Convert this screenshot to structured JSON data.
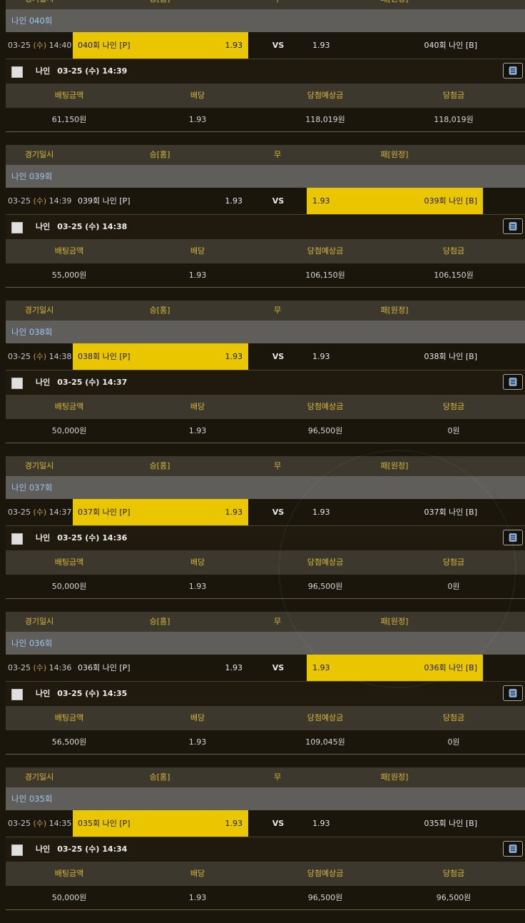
{
  "header_labels": {
    "date": "경기일시",
    "home": "승[홈]",
    "draw": "무",
    "away": "패[원정]"
  },
  "vs_label": "VS",
  "stats_labels": {
    "amount": "배팅금액",
    "odds": "배당",
    "expected": "당첨예상금",
    "won": "당첨금"
  },
  "bets": [
    {
      "league": "나인 040회",
      "date": "03-25",
      "dow": "(수)",
      "time": "14:40",
      "home": "040회 나인 [P]",
      "away": "040회 나인 [B]",
      "home_odds": "1.93",
      "away_odds": "1.93",
      "selected": "home",
      "user": "나인",
      "bet_time": "03-25 (수) 14:39",
      "amount": "61,150원",
      "odds": "1.93",
      "expected": "118,019원",
      "won": "118,019원"
    },
    {
      "league": "나인 039회",
      "date": "03-25",
      "dow": "(수)",
      "time": "14:39",
      "home": "039회 나인 [P]",
      "away": "039회 나인 [B]",
      "home_odds": "1.93",
      "away_odds": "1.93",
      "selected": "away",
      "user": "나인",
      "bet_time": "03-25 (수) 14:38",
      "amount": "55,000원",
      "odds": "1.93",
      "expected": "106,150원",
      "won": "106,150원"
    },
    {
      "league": "나인 038회",
      "date": "03-25",
      "dow": "(수)",
      "time": "14:38",
      "home": "038회 나인 [P]",
      "away": "038회 나인 [B]",
      "home_odds": "1.93",
      "away_odds": "1.93",
      "selected": "home",
      "user": "나인",
      "bet_time": "03-25 (수) 14:37",
      "amount": "50,000원",
      "odds": "1.93",
      "expected": "96,500원",
      "won": "0원"
    },
    {
      "league": "나인 037회",
      "date": "03-25",
      "dow": "(수)",
      "time": "14:37",
      "home": "037회 나인 [P]",
      "away": "037회 나인 [B]",
      "home_odds": "1.93",
      "away_odds": "1.93",
      "selected": "home",
      "user": "나인",
      "bet_time": "03-25 (수) 14:36",
      "amount": "50,000원",
      "odds": "1.93",
      "expected": "96,500원",
      "won": "0원"
    },
    {
      "league": "나인 036회",
      "date": "03-25",
      "dow": "(수)",
      "time": "14:36",
      "home": "036회 나인 [P]",
      "away": "036회 나인 [B]",
      "home_odds": "1.93",
      "away_odds": "1.93",
      "selected": "away",
      "user": "나인",
      "bet_time": "03-25 (수) 14:35",
      "amount": "56,500원",
      "odds": "1.93",
      "expected": "109,045원",
      "won": "0원"
    },
    {
      "league": "나인 035회",
      "date": "03-25",
      "dow": "(수)",
      "time": "14:35",
      "home": "035회 나인 [P]",
      "away": "035회 나인 [B]",
      "home_odds": "1.93",
      "away_odds": "1.93",
      "selected": "home",
      "user": "나인",
      "bet_time": "03-25 (수) 14:34",
      "amount": "50,000원",
      "odds": "1.93",
      "expected": "96,500원",
      "won": "96,500원"
    }
  ],
  "colors": {
    "selected_bg": "#eac600",
    "header_bg": "#3c382d",
    "header_text": "#d8b93a",
    "league_bg": "#5f5e5a",
    "league_text": "#9cc6ef"
  },
  "icons": {
    "checkbox": "checkbox-icon",
    "detail": "document-list-icon"
  }
}
